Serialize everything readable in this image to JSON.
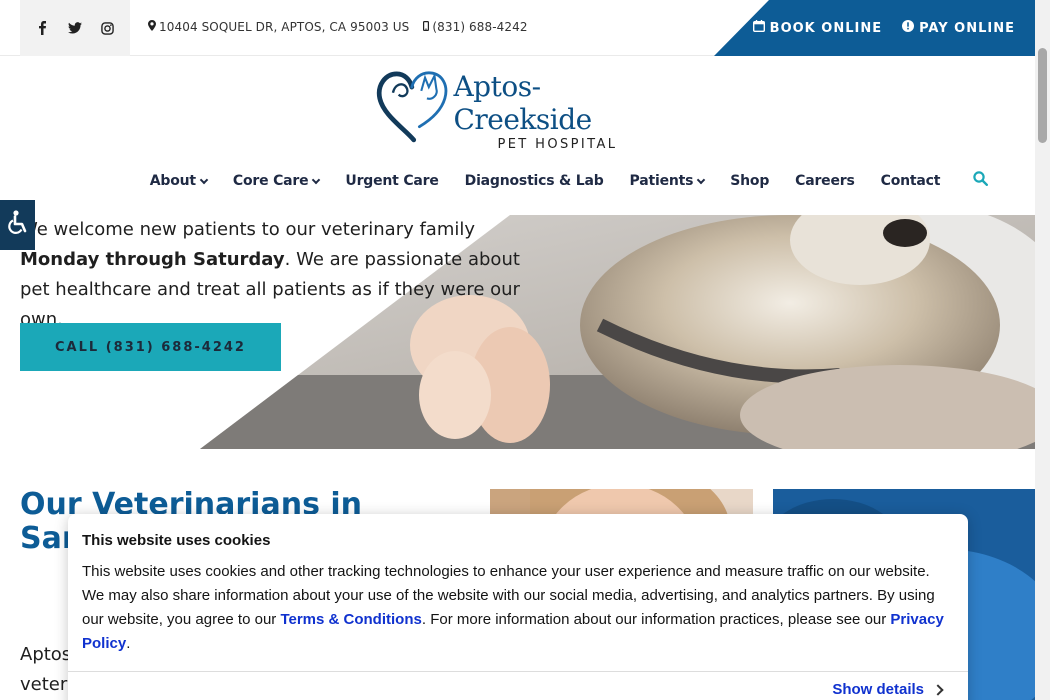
{
  "topbar": {
    "social": [
      {
        "icon": "facebook-icon",
        "glyph": "f"
      },
      {
        "icon": "twitter-icon"
      },
      {
        "icon": "instagram-icon"
      }
    ],
    "address": "10404 SOQUEL DR, APTOS, CA 95003 US",
    "phone": "(831) 688-4242",
    "book_online": "BOOK ONLINE",
    "pay_online": "PAY ONLINE",
    "accent": "#0d5c96"
  },
  "logo": {
    "name": "Aptos-Creekside",
    "subtitle": "PET HOSPITAL"
  },
  "nav": {
    "items": [
      {
        "label": "About",
        "dropdown": true
      },
      {
        "label": "Core Care",
        "dropdown": true
      },
      {
        "label": "Urgent Care",
        "dropdown": false
      },
      {
        "label": "Diagnostics & Lab",
        "dropdown": false
      },
      {
        "label": "Patients",
        "dropdown": true
      },
      {
        "label": "Shop",
        "dropdown": false
      },
      {
        "label": "Careers",
        "dropdown": false
      },
      {
        "label": "Contact",
        "dropdown": false
      }
    ],
    "search_icon": "search-icon",
    "search_color": "#1ba8b8"
  },
  "hero": {
    "text_pre": "We welcome new patients to our veterinary family ",
    "text_bold": "Monday through Saturday",
    "text_post": ". We are passionate about pet healthcare and treat all patients as if they were our own.",
    "call_button": "CALL (831) 688-4242",
    "button_color": "#1ba8b8"
  },
  "vets": {
    "title": "Our Veterinarians in Santa Cruz Patients Incl",
    "body": "Aptos veter"
  },
  "cookie": {
    "title": "This website uses cookies",
    "text_1": "This website uses cookies and other tracking technologies to enhance your user experience and measure traffic on our website. We may also share information about your use of the website with our social media, advertising, and analytics partners. By using our website, you agree to our ",
    "terms_link": "Terms & Conditions",
    "text_2": ". For more information about our information practices, please see our ",
    "privacy_link": "Privacy Policy",
    "text_3": ".",
    "show_details": "Show details",
    "link_color": "#1032cf"
  }
}
